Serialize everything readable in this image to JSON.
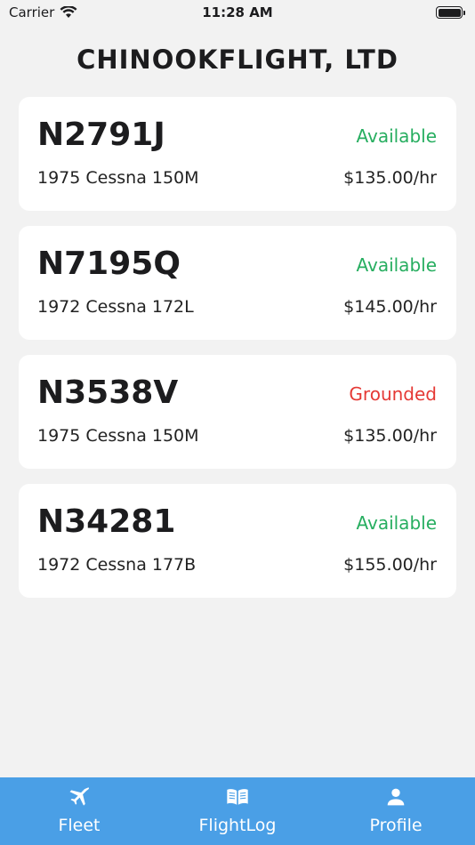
{
  "status_bar": {
    "carrier": "Carrier",
    "time": "11:28 AM"
  },
  "title": "CHINOOKFLIGHT, LTD",
  "aircraft": [
    {
      "tail": "N2791J",
      "status": "Available",
      "model": "1975 Cessna 150M",
      "rate": "$135.00/hr"
    },
    {
      "tail": "N7195Q",
      "status": "Available",
      "model": "1972 Cessna 172L",
      "rate": "$145.00/hr"
    },
    {
      "tail": "N3538V",
      "status": "Grounded",
      "model": "1975 Cessna 150M",
      "rate": "$135.00/hr"
    },
    {
      "tail": "N34281",
      "status": "Available",
      "model": "1972 Cessna 177B",
      "rate": "$155.00/hr"
    }
  ],
  "tabs": [
    {
      "label": "Fleet",
      "icon": "airplane-icon"
    },
    {
      "label": "FlightLog",
      "icon": "book-icon"
    },
    {
      "label": "Profile",
      "icon": "person-icon"
    }
  ],
  "colors": {
    "available": "#27ae60",
    "grounded": "#e53935",
    "tab_bar": "#4a9fe6"
  }
}
